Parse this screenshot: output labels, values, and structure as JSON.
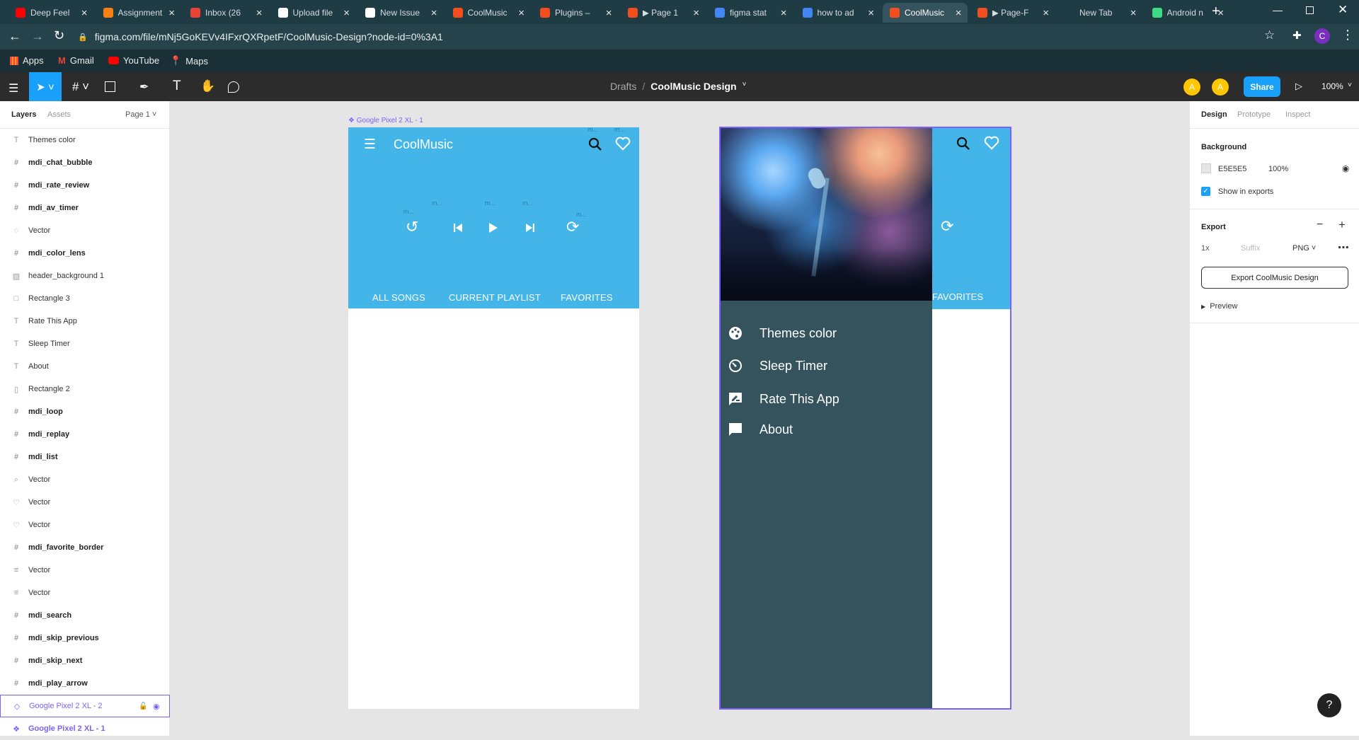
{
  "browser": {
    "tabs": [
      {
        "title": "Deep Feel",
        "icon": "youtube-icon",
        "color": "#ff0000"
      },
      {
        "title": "Assignment",
        "icon": "moodle-icon",
        "color": "#f98012"
      },
      {
        "title": "Inbox (26",
        "icon": "gmail-icon",
        "color": "#ea4335"
      },
      {
        "title": "Upload file",
        "icon": "github-icon",
        "color": "#ffffff"
      },
      {
        "title": "New Issue",
        "icon": "github-icon",
        "color": "#ffffff"
      },
      {
        "title": "CoolMusic",
        "icon": "figma-icon",
        "color": "#f24e1e"
      },
      {
        "title": "Plugins –",
        "icon": "figma-icon",
        "color": "#f24e1e"
      },
      {
        "title": "▶ Page 1",
        "icon": "figma-icon",
        "color": "#f24e1e"
      },
      {
        "title": "figma stat",
        "icon": "google-icon",
        "color": "#4285f4"
      },
      {
        "title": "how to ad",
        "icon": "google-icon",
        "color": "#4285f4"
      },
      {
        "title": "CoolMusic",
        "icon": "figma-icon",
        "color": "#f24e1e"
      },
      {
        "title": "▶ Page-F",
        "icon": "figma-icon",
        "color": "#f24e1e"
      },
      {
        "title": "New Tab",
        "icon": "",
        "color": ""
      },
      {
        "title": "Android n",
        "icon": "android-icon",
        "color": "#3ddc84"
      }
    ],
    "active_tab": 10,
    "url": "figma.com/file/mNj5GoKEVv4IFxrQXRpetF/CoolMusic-Design?node-id=0%3A1",
    "bookmarks": [
      {
        "label": "Apps",
        "icon": "apps-grid-icon"
      },
      {
        "label": "Gmail",
        "icon": "gmail-icon"
      },
      {
        "label": "YouTube",
        "icon": "youtube-icon"
      },
      {
        "label": "Maps",
        "icon": "maps-icon"
      }
    ],
    "profile_initial": "C"
  },
  "figma_toolbar": {
    "breadcrumb_root": "Drafts",
    "separator": "/",
    "file_name": "CoolMusic Design",
    "avatar_1": "A",
    "avatar_2": "A",
    "share_label": "Share",
    "zoom": "100%"
  },
  "left_panel": {
    "tab_layers": "Layers",
    "tab_assets": "Assets",
    "page": "Page 1",
    "layers": [
      {
        "icon": "T",
        "name": "Themes color",
        "bold": false
      },
      {
        "icon": "#",
        "name": "mdi_chat_bubble",
        "bold": true
      },
      {
        "icon": "#",
        "name": "mdi_rate_review",
        "bold": true
      },
      {
        "icon": "#",
        "name": "mdi_av_timer",
        "bold": true
      },
      {
        "icon": "◌",
        "name": "Vector",
        "bold": false
      },
      {
        "icon": "#",
        "name": "mdi_color_lens",
        "bold": true
      },
      {
        "icon": "▨",
        "name": "header_background 1",
        "bold": false
      },
      {
        "icon": "□",
        "name": "Rectangle 3",
        "bold": false
      },
      {
        "icon": "T",
        "name": "Rate This App",
        "bold": false
      },
      {
        "icon": "T",
        "name": "Sleep Timer",
        "bold": false
      },
      {
        "icon": "T",
        "name": "About",
        "bold": false
      },
      {
        "icon": "▯",
        "name": "Rectangle 2",
        "bold": false
      },
      {
        "icon": "#",
        "name": "mdi_loop",
        "bold": true
      },
      {
        "icon": "#",
        "name": "mdi_replay",
        "bold": true
      },
      {
        "icon": "#",
        "name": "mdi_list",
        "bold": true
      },
      {
        "icon": "⌕",
        "name": "Vector",
        "bold": false
      },
      {
        "icon": "♡",
        "name": "Vector",
        "bold": false
      },
      {
        "icon": "♡",
        "name": "Vector",
        "bold": false
      },
      {
        "icon": "#",
        "name": "mdi_favorite_border",
        "bold": true
      },
      {
        "icon": "≡",
        "name": "Vector",
        "bold": false
      },
      {
        "icon": "≡",
        "name": "Vector",
        "bold": false
      },
      {
        "icon": "#",
        "name": "mdi_search",
        "bold": true
      },
      {
        "icon": "#",
        "name": "mdi_skip_previous",
        "bold": true
      },
      {
        "icon": "#",
        "name": "mdi_skip_next",
        "bold": true
      },
      {
        "icon": "#",
        "name": "mdi_play_arrow",
        "bold": true
      }
    ],
    "selected_frame": "Google Pixel 2 XL - 2",
    "last_frame": "Google Pixel 2 XL - 1"
  },
  "right_panel": {
    "tab_design": "Design",
    "tab_prototype": "Prototype",
    "tab_inspect": "Inspect",
    "background_title": "Background",
    "bg_hex": "E5E5E5",
    "bg_opacity": "100%",
    "show_in_exports": "Show in exports",
    "export_title": "Export",
    "export_scale": "1x",
    "export_suffix_placeholder": "Suffix",
    "export_format": "PNG",
    "export_button": "Export CoolMusic Design",
    "preview_label": "Preview"
  },
  "canvas": {
    "frame1_label": "Google Pixel 2 XL - 1",
    "app_title": "CoolMusic",
    "tabs": [
      "ALL SONGS",
      "CURRENT PLAYLIST",
      "FAVORITES"
    ],
    "hint": "m...",
    "drawer_items": [
      {
        "icon": "palette-icon",
        "label": "Themes color"
      },
      {
        "icon": "timer-icon",
        "label": "Sleep Timer"
      },
      {
        "icon": "rate-review-icon",
        "label": "Rate This App"
      },
      {
        "icon": "chat-bubble-icon",
        "label": "About"
      }
    ],
    "frame2_tab": "FAVORITES",
    "colors": {
      "app_bar": "#43b5e8",
      "drawer": "#34535d",
      "selection": "#7b61ff"
    }
  },
  "help": "?"
}
